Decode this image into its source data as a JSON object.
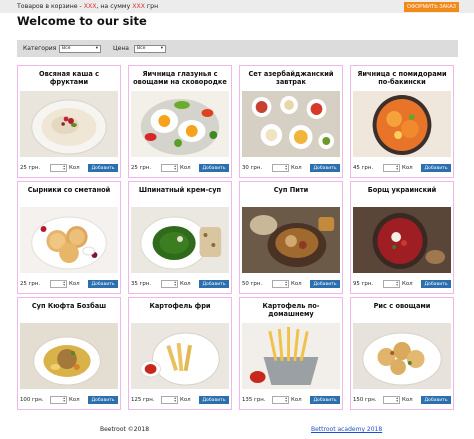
{
  "topbar": {
    "cart_prefix": "Товаров в корзине - ",
    "cart_count": "XXX",
    "cart_middle": ", на сумму ",
    "cart_sum": "XXX",
    "cart_suffix": " грн",
    "order_button": "ОФОРМИТЬ ЗАКАЗ"
  },
  "page_title": "Welcome to our site",
  "filters": {
    "category_label": "Категория",
    "category_value": "Все",
    "price_label": "Цена",
    "price_value": "Все"
  },
  "products": [
    {
      "name": "Овсяная каша с фруктами",
      "price": "25 грн.",
      "qty_label": "Кол",
      "add_label": "Добавить",
      "icon": "oatmeal-plate"
    },
    {
      "name": "Яичница глазунья с овощами на сковородке",
      "price": "25 грн.",
      "qty_label": "Кол",
      "add_label": "Добавить",
      "icon": "fried-eggs-plate"
    },
    {
      "name": "Сет азербайджанский завтрак",
      "price": "30 грн.",
      "qty_label": "Кол",
      "add_label": "Добавить",
      "icon": "breakfast-set"
    },
    {
      "name": "Яичница с помидорами по-бакински",
      "price": "45 грн.",
      "qty_label": "Кол",
      "add_label": "Добавить",
      "icon": "tomato-eggs-pan"
    },
    {
      "name": "Сырники со сметаной",
      "price": "25 грн.",
      "qty_label": "Кол",
      "add_label": "Добавить",
      "icon": "syrniki-plate"
    },
    {
      "name": "Шпинатный крем-суп",
      "price": "35 грн.",
      "qty_label": "Кол",
      "add_label": "Добавить",
      "icon": "spinach-soup"
    },
    {
      "name": "Суп Пити",
      "price": "50 грн.",
      "qty_label": "Кол",
      "add_label": "Добавить",
      "icon": "piti-soup"
    },
    {
      "name": "Борщ украинский",
      "price": "95 грн.",
      "qty_label": "Кол",
      "add_label": "Добавить",
      "icon": "borscht-bowl"
    },
    {
      "name": "Суп Кюфта Бозбаш",
      "price": "100 грн.",
      "qty_label": "Кол",
      "add_label": "Добавить",
      "icon": "kufta-soup"
    },
    {
      "name": "Картофель фри",
      "price": "125 грн.",
      "qty_label": "Кол",
      "add_label": "Добавить",
      "icon": "fries-plate"
    },
    {
      "name": "Картофель по-домашнему",
      "price": "135 грн.",
      "qty_label": "Кол",
      "add_label": "Добавить",
      "icon": "fries-basket"
    },
    {
      "name": "Рис с овощами",
      "price": "150 грн.",
      "qty_label": "Кол",
      "add_label": "Добавить",
      "icon": "potato-plate"
    }
  ],
  "footer": {
    "left": "Beetroot ©2018",
    "right_link": "Bettroot academy 2018"
  },
  "colors": {
    "accent_order": "#f28a1a",
    "add_button": "#2c6fae",
    "card_border": "#f0b8ea",
    "highlight": "#e03030"
  }
}
